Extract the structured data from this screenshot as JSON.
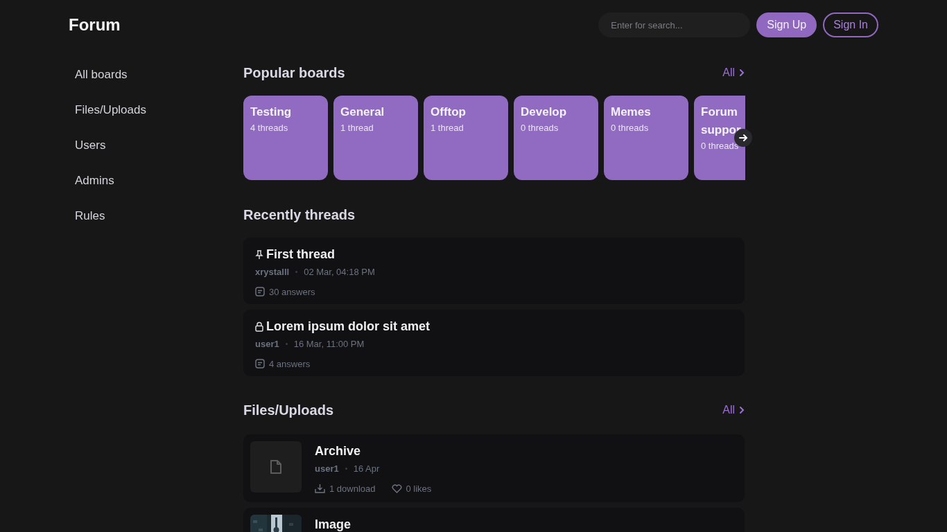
{
  "header": {
    "logo": "Forum",
    "search": {
      "placeholder": "Enter for search..."
    },
    "buttons": [
      {
        "label": "Sign Up",
        "kind": "filled"
      },
      {
        "label": "Sign In",
        "kind": "outline"
      }
    ]
  },
  "sidebar": {
    "items": [
      "All boards",
      "Files/Uploads",
      "Users",
      "Admins",
      "Rules"
    ]
  },
  "popular_boards": {
    "title": "Popular boards",
    "all_link": "All",
    "boards": [
      {
        "name": "Testing",
        "count": "4 threads"
      },
      {
        "name": "General",
        "count": "1 thread"
      },
      {
        "name": "Offtop",
        "count": "1 thread"
      },
      {
        "name": "Develop",
        "count": "0 threads"
      },
      {
        "name": "Memes",
        "count": "0 threads"
      },
      {
        "name": "Forum suppor",
        "count": "0 threads",
        "cut": true
      }
    ]
  },
  "recent_threads": {
    "title": "Recently threads",
    "threads": [
      {
        "kind": "pinned",
        "title": "First thread",
        "author": "xrystalll",
        "date": "02 Mar, 04:18 PM",
        "answers": "30 answers"
      },
      {
        "kind": "locked",
        "title": "Lorem ipsum dolor sit amet",
        "author": "user1",
        "date": "16 Mar, 11:00 PM",
        "answers": "4 answers"
      }
    ]
  },
  "files": {
    "title": "Files/Uploads",
    "all_link": "All",
    "items": [
      {
        "kind": "file",
        "name": "Archive",
        "author": "user1",
        "date": "16 Apr",
        "downloads": "1 download",
        "likes": "0 likes"
      },
      {
        "kind": "picture",
        "name": "Image"
      }
    ]
  }
}
